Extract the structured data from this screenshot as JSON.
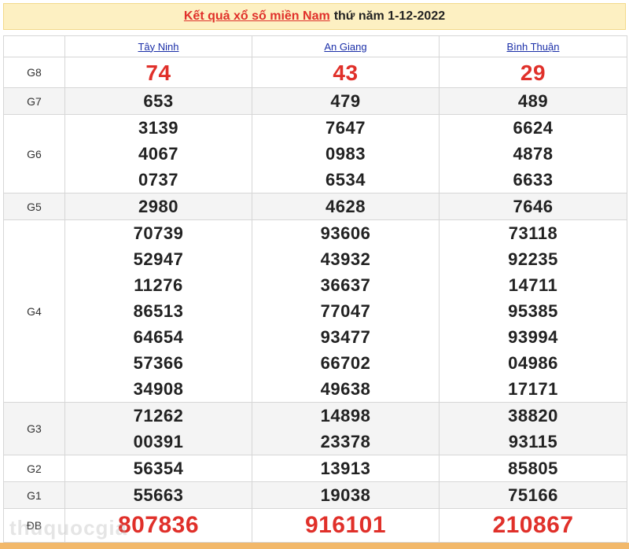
{
  "header": {
    "link_text": "Kết quả xổ số miền Nam",
    "date_text": "thứ năm 1-12-2022"
  },
  "provinces": [
    "Tây Ninh",
    "An Giang",
    "Bình Thuận"
  ],
  "prizes": [
    {
      "label": "G8",
      "style": "red",
      "values": [
        [
          "74"
        ],
        [
          "43"
        ],
        [
          "29"
        ]
      ]
    },
    {
      "label": "G7",
      "style": "normal",
      "values": [
        [
          "653"
        ],
        [
          "479"
        ],
        [
          "489"
        ]
      ]
    },
    {
      "label": "G6",
      "style": "normal",
      "values": [
        [
          "3139",
          "4067",
          "0737"
        ],
        [
          "7647",
          "0983",
          "6534"
        ],
        [
          "6624",
          "4878",
          "6633"
        ]
      ]
    },
    {
      "label": "G5",
      "style": "normal",
      "values": [
        [
          "2980"
        ],
        [
          "4628"
        ],
        [
          "7646"
        ]
      ]
    },
    {
      "label": "G4",
      "style": "normal",
      "values": [
        [
          "70739",
          "52947",
          "11276",
          "86513",
          "64654",
          "57366",
          "34908"
        ],
        [
          "93606",
          "43932",
          "36637",
          "77047",
          "93477",
          "66702",
          "49638"
        ],
        [
          "73118",
          "92235",
          "14711",
          "95385",
          "93994",
          "04986",
          "17171"
        ]
      ]
    },
    {
      "label": "G3",
      "style": "normal",
      "values": [
        [
          "71262",
          "00391"
        ],
        [
          "14898",
          "23378"
        ],
        [
          "38820",
          "93115"
        ]
      ]
    },
    {
      "label": "G2",
      "style": "normal",
      "values": [
        [
          "56354"
        ],
        [
          "13913"
        ],
        [
          "85805"
        ]
      ]
    },
    {
      "label": "G1",
      "style": "normal",
      "values": [
        [
          "55663"
        ],
        [
          "19038"
        ],
        [
          "75166"
        ]
      ]
    },
    {
      "label": "ĐB",
      "style": "db",
      "values": [
        [
          "807836"
        ],
        [
          "916101"
        ],
        [
          "210867"
        ]
      ]
    }
  ],
  "watermark": "thuquocgia",
  "colors": {
    "accent": "#e0302a",
    "header_bg": "#fdf0c2",
    "link": "#1b2fa8"
  }
}
